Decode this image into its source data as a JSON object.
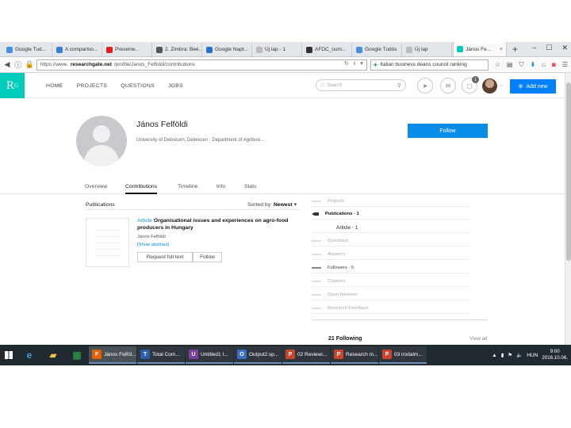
{
  "browser": {
    "tabs": [
      {
        "label": "Google Tud...",
        "color": "#4a90e2"
      },
      {
        "label": "A compariso...",
        "color": "#3b7dd8"
      },
      {
        "label": "Presenw...",
        "color": "#e02020"
      },
      {
        "label": "2. Zimbra: Beé...",
        "color": "#555555"
      },
      {
        "label": "Google Napt...",
        "color": "#2f6fd0"
      },
      {
        "label": "Új lap - 1",
        "color": "#bbbbbb"
      },
      {
        "label": "AFDC_oum...",
        "color": "#333333"
      },
      {
        "label": "Google Tudós",
        "color": "#4a90e2"
      },
      {
        "label": "Új lap",
        "color": "#bbbbbb"
      }
    ],
    "active_tab": {
      "label": "János Fe...",
      "close": "×"
    },
    "new_tab": "+",
    "window_controls": [
      "–",
      "☐",
      "✕"
    ],
    "url_prefix": "https://www.",
    "url_domain": "researchgate.net",
    "url_path": "/profile/Janos_Felfoldi/contributions",
    "search_text": "Italian business deans council ranking"
  },
  "site": {
    "logo": "R",
    "logo_sup": "G",
    "nav": [
      "HOME",
      "PROJECTS",
      "QUESTIONS",
      "JOBS"
    ],
    "search_placeholder": "Search",
    "notif_count": "1",
    "add_new": "Add new",
    "accent": "#00ccbb",
    "primary": "#0a8ce9"
  },
  "profile": {
    "name": "János Felföldi",
    "affiliation": "University of Debrecen, Debrecen · Department of Agribusi...",
    "follow": "Follow",
    "tabs": [
      "Overview",
      "Contributions",
      "Timeline",
      "Info",
      "Stats"
    ],
    "active_tab": "Contributions"
  },
  "publications": {
    "label": "Publications",
    "sort_prefix": "Sorted by:",
    "sort_value": "Newest",
    "item": {
      "type": "Article",
      "title": "Organisational issues and experiences on agro-food producers in Hungary",
      "author": "János Felföldi",
      "show_abstract": "[Show abstract]",
      "request": "Request full text",
      "follow": "Follow"
    }
  },
  "sidebar": {
    "rows": [
      {
        "label": "Projects",
        "style": ""
      },
      {
        "label": "Publications · 1",
        "style": "bold"
      },
      {
        "label": "Article · 1",
        "style": "sub"
      },
      {
        "label": "Questions",
        "style": ""
      },
      {
        "label": "Answers",
        "style": ""
      },
      {
        "label": "Followers · 5",
        "style": "dark"
      },
      {
        "label": "Citations",
        "style": ""
      },
      {
        "label": "Open Reviews",
        "style": ""
      },
      {
        "label": "Research Feedback",
        "style": ""
      }
    ],
    "following": "21 Following",
    "view_all": "View all"
  },
  "taskbar": {
    "apps": [
      {
        "label": "János Felföl...",
        "color": "#e66000",
        "glyph": "F",
        "active": true
      },
      {
        "label": "Total Com...",
        "color": "#2d5fa8",
        "glyph": "T",
        "active": false
      },
      {
        "label": "Untitled1 I...",
        "color": "#7a3fa0",
        "glyph": "U",
        "active": false
      },
      {
        "label": "Output2.sp...",
        "color": "#3a6fc4",
        "glyph": "O",
        "active": false
      },
      {
        "label": "02 Reviewi...",
        "color": "#c9462c",
        "glyph": "P",
        "active": false
      },
      {
        "label": "Research m...",
        "color": "#c9462c",
        "glyph": "P",
        "active": false
      },
      {
        "label": "03 irodalm...",
        "color": "#c9462c",
        "glyph": "P",
        "active": false
      }
    ],
    "lang": "HUN",
    "time": "9:00",
    "date": "2016.10.06."
  }
}
